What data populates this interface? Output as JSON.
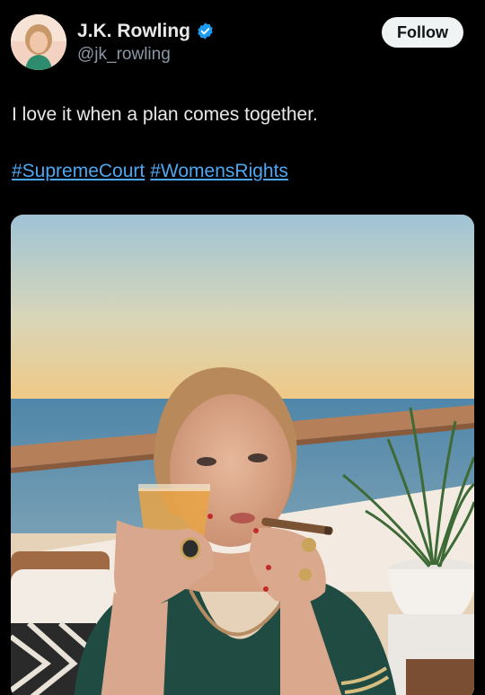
{
  "author": {
    "display_name": "J.K. Rowling",
    "handle": "@jk_rowling",
    "verified": true,
    "avatar_icon": "profile-photo"
  },
  "actions": {
    "follow_label": "Follow"
  },
  "tweet": {
    "text": "I love it when a plan comes together.",
    "hashtags": [
      "#SupremeCourt",
      "#WomensRights"
    ]
  },
  "media": {
    "type": "photo",
    "alt_icon": "photo-woman-with-cigar-and-drink-on-deck"
  },
  "colors": {
    "background": "#000000",
    "text": "#e7e9ea",
    "secondary_text": "#8b98a5",
    "link": "#4ea7f0",
    "verified_badge": "#1d9bf0",
    "follow_button_bg": "#eff3f4"
  }
}
